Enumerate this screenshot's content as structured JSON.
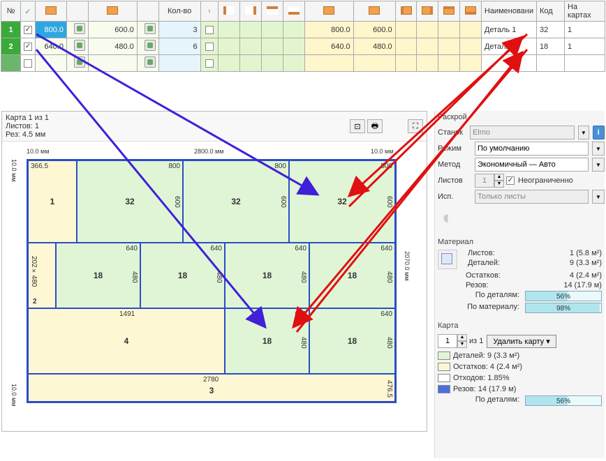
{
  "table": {
    "headers": {
      "num": "№",
      "count": "Кол-во",
      "name": "Наименовани",
      "code": "Код",
      "on_maps": "На картах"
    },
    "rows": [
      {
        "num": "1",
        "width": "800.0",
        "height": "600.0",
        "qty": "3",
        "w2": "800.0",
        "h2": "600.0",
        "name": "Деталь 1",
        "code": "32",
        "maps": "1"
      },
      {
        "num": "2",
        "width": "640.0",
        "height": "480.0",
        "qty": "6",
        "w2": "640.0",
        "h2": "480.0",
        "name": "Деталь 2",
        "code": "18",
        "maps": "1"
      }
    ]
  },
  "layout": {
    "title1": "Карта 1 из 1",
    "title2": "Листов:  1",
    "title3": "Рез: 4.5 мм",
    "dim_left": "10.0 мм",
    "dim_top": "2800.0 мм",
    "dim_right": "10.0 мм",
    "vdim_left": "10.0 мм",
    "vdim_mid": "2070.0 мм",
    "vdim_right": "10.0 мм",
    "pieces": {
      "p1_w": "366.5",
      "p1_n": "1",
      "p32_w": "800",
      "p32_h": "600",
      "p32_c": "32",
      "p640": "640",
      "p480": "480",
      "p18_c": "18",
      "p202x480": "202×480",
      "p202_n": "2",
      "p1491": "1491",
      "p4_n": "4",
      "p2780": "2780",
      "p3_n": "3",
      "p476": "476.5"
    }
  },
  "right": {
    "section_cut": "Раскрой",
    "machine_lbl": "Станок",
    "machine_val": "Elmo",
    "mode_lbl": "Режим",
    "mode_val": "По умолчанию",
    "method_lbl": "Метод",
    "method_val": "Экономичный — Авто",
    "sheets_lbl": "Листов",
    "sheets_val": "1",
    "unlimited": "Неограниченно",
    "use_lbl": "Исп.",
    "use_val": "Только листы",
    "section_mat": "Материал",
    "mat_sheets": "Листов:",
    "mat_sheets_v": "1 (5.8 м²)",
    "mat_parts": "Деталей:",
    "mat_parts_v": "9 (3.3 м²)",
    "mat_rem": "Остатков:",
    "mat_rem_v": "4 (2.4 м²)",
    "mat_cuts": "Резов:",
    "mat_cuts_v": "14 (17.9 м)",
    "by_parts": "По деталям:",
    "by_parts_v": "56%",
    "by_mat": "По материалу:",
    "by_mat_v": "98%",
    "section_map": "Карта",
    "map_of": "из 1",
    "map_num": "1",
    "del_map": "Удалить карту",
    "c_parts": "Деталей:",
    "c_parts_v": "9 (3.3 м²)",
    "c_rem": "Остатков:",
    "c_rem_v": "4 (2.4 м²)",
    "c_waste": "Отходов:",
    "c_waste_v": "1.85%",
    "c_cuts": "Резов:",
    "c_cuts_v": "14 (17.9 м)",
    "c_byparts": "По деталям:",
    "c_byparts_v": "56%"
  }
}
